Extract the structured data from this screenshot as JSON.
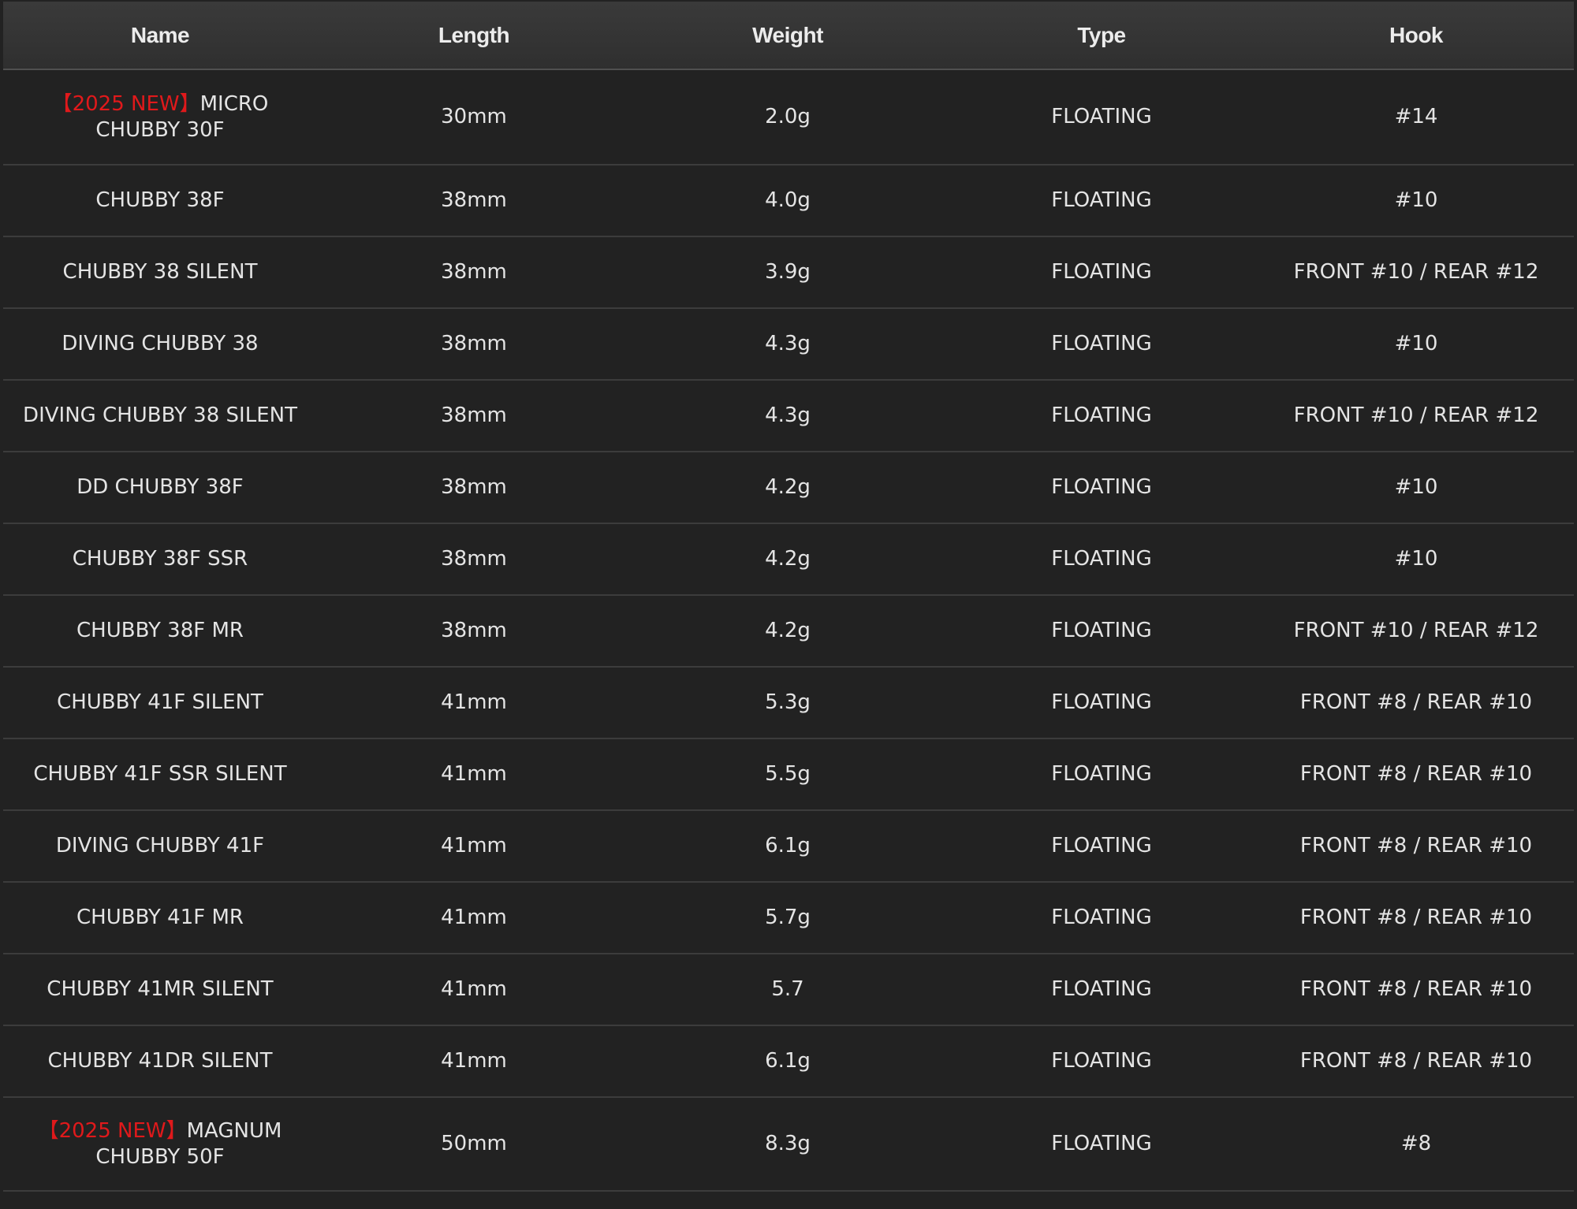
{
  "table": {
    "headers": [
      "Name",
      "Length",
      "Weight",
      "Type",
      "Hook"
    ],
    "rows": [
      {
        "tag": "【2025 NEW】",
        "name": "MICRO",
        "name2": "CHUBBY 30F",
        "length": "30mm",
        "weight": "2.0g",
        "type": "FLOATING",
        "hook": "#14"
      },
      {
        "tag": "",
        "name": "CHUBBY 38F",
        "name2": "",
        "length": "38mm",
        "weight": "4.0g",
        "type": "FLOATING",
        "hook": "#10"
      },
      {
        "tag": "",
        "name": "CHUBBY 38 SILENT",
        "name2": "",
        "length": "38mm",
        "weight": "3.9g",
        "type": "FLOATING",
        "hook": "FRONT #10 / REAR #12"
      },
      {
        "tag": "",
        "name": "DIVING CHUBBY 38",
        "name2": "",
        "length": "38mm",
        "weight": "4.3g",
        "type": "FLOATING",
        "hook": "#10"
      },
      {
        "tag": "",
        "name": "DIVING CHUBBY 38 SILENT",
        "name2": "",
        "length": "38mm",
        "weight": "4.3g",
        "type": "FLOATING",
        "hook": "FRONT #10 / REAR #12"
      },
      {
        "tag": "",
        "name": "DD CHUBBY 38F",
        "name2": "",
        "length": "38mm",
        "weight": "4.2g",
        "type": "FLOATING",
        "hook": "#10"
      },
      {
        "tag": "",
        "name": "CHUBBY 38F SSR",
        "name2": "",
        "length": "38mm",
        "weight": "4.2g",
        "type": "FLOATING",
        "hook": "#10"
      },
      {
        "tag": "",
        "name": "CHUBBY 38F MR",
        "name2": "",
        "length": "38mm",
        "weight": "4.2g",
        "type": "FLOATING",
        "hook": "FRONT #10 / REAR #12"
      },
      {
        "tag": "",
        "name": "CHUBBY 41F SILENT",
        "name2": "",
        "length": "41mm",
        "weight": "5.3g",
        "type": "FLOATING",
        "hook": "FRONT #8 / REAR #10"
      },
      {
        "tag": "",
        "name": "CHUBBY 41F SSR SILENT",
        "name2": "",
        "length": "41mm",
        "weight": "5.5g",
        "type": "FLOATING",
        "hook": "FRONT #8 / REAR #10"
      },
      {
        "tag": "",
        "name": "DIVING CHUBBY 41F",
        "name2": "",
        "length": "41mm",
        "weight": "6.1g",
        "type": "FLOATING",
        "hook": "FRONT #8 / REAR #10"
      },
      {
        "tag": "",
        "name": "CHUBBY 41F MR",
        "name2": "",
        "length": "41mm",
        "weight": "5.7g",
        "type": "FLOATING",
        "hook": "FRONT #8 / REAR #10"
      },
      {
        "tag": "",
        "name": "CHUBBY 41MR SILENT",
        "name2": "",
        "length": "41mm",
        "weight": "5.7",
        "type": "FLOATING",
        "hook": "FRONT #8 / REAR #10"
      },
      {
        "tag": "",
        "name": "CHUBBY 41DR SILENT",
        "name2": "",
        "length": "41mm",
        "weight": "6.1g",
        "type": "FLOATING",
        "hook": "FRONT #8 / REAR #10"
      },
      {
        "tag": "【2025 NEW】",
        "name": "MAGNUM",
        "name2": "CHUBBY 50F",
        "length": "50mm",
        "weight": "8.3g",
        "type": "FLOATING",
        "hook": "#8"
      }
    ]
  },
  "colors": {
    "background": "#222222",
    "header": "#353535",
    "new_tag": "#e0191b"
  }
}
